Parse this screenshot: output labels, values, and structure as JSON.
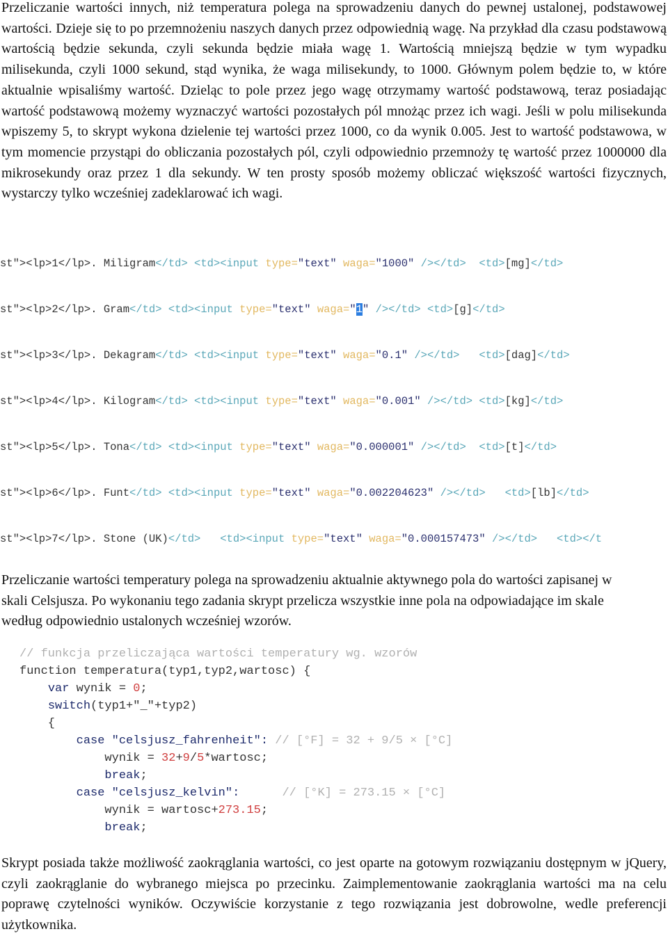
{
  "paragraphs": [
    "Przeliczanie wartości innych, niż temperatura polega na sprowadzeniu danych do pewnej ustalonej, podstawowej wartości. Dzieje się to po przemnożeniu naszych danych przez odpowiednią wagę. Na przykład dla czasu podstawową wartością będzie sekunda, czyli sekunda będzie miała wagę 1. Wartością mniejszą będzie w tym wypadku milisekunda, czyli 1000 sekund, stąd wynika, że waga milisekundy, to 1000. Głównym polem będzie to, w które aktualnie wpisaliśmy wartość. Dzieląc to pole przez jego wagę otrzymamy wartość podstawową, teraz posiadając wartość podstawową możemy wyznaczyć wartości pozostałych pól mnożąc przez ich wagi. Jeśli w polu milisekunda wpiszemy 5, to skrypt wykona dzielenie tej wartości przez 1000, co da wynik 0.005. Jest to wartość podstawowa, w tym momencie przystąpi do obliczania pozostałych pól, czyli odpowiednio przemnoży tę wartość przez 1000000 dla mikrosekundy oraz przez 1 dla sekundy. W ten prosty sposób możemy obliczać większość wartości fizycznych, wystarczy tylko wcześniej zadeklarować ich wagi.",
    "Przeliczanie wartości temperatury polega na sprowadzeniu aktualnie aktywnego pola do wartości zapisanej w skali Celsjusza. Po wykonaniu tego zadania skrypt przelicza wszystkie inne pola na odpowiadające im skale według odpowiednio ustalonych wcześniej wzorów.",
    "Skrypt posiada także możliwość zaokrąglania wartości, co jest oparte na gotowym rozwiązaniu dostępnym w jQuery, czyli zaokrąglanie do wybranego miejsca po przecinku. Zaimplementowanie zaokrąglania wartości ma na celu poprawę czytelności wyników. Oczywiście korzystanie z tego rozwiązania jest dobrowolne, wedle preferencji użytkownika."
  ],
  "html_code_lines": [
    [
      [
        "st\"><lp>1</lp>. Miligram",
        "p"
      ],
      [
        "</td> <td><input ",
        "t"
      ],
      [
        "type=",
        "a"
      ],
      [
        "\"text\" ",
        "s"
      ],
      [
        "waga=",
        "a"
      ],
      [
        "\"1000\" ",
        "s"
      ],
      [
        "/></td>  ",
        "t"
      ],
      [
        "<td>",
        "t"
      ],
      [
        "[mg]",
        "p"
      ],
      [
        "</td>",
        "t"
      ]
    ],
    [
      [
        "st\"><lp>2</lp>. Gram",
        "p"
      ],
      [
        "</td> <td><input ",
        "t"
      ],
      [
        "type=",
        "a"
      ],
      [
        "\"text\" ",
        "s"
      ],
      [
        "waga=",
        "a"
      ],
      [
        "\"",
        "s"
      ],
      [
        "1",
        "h"
      ],
      [
        "\" ",
        "s"
      ],
      [
        "/></td> ",
        "t"
      ],
      [
        "<td>",
        "t"
      ],
      [
        "[g]",
        "p"
      ],
      [
        "</td>",
        "t"
      ]
    ],
    [
      [
        "st\"><lp>3</lp>. Dekagram",
        "p"
      ],
      [
        "</td> <td><input ",
        "t"
      ],
      [
        "type=",
        "a"
      ],
      [
        "\"text\" ",
        "s"
      ],
      [
        "waga=",
        "a"
      ],
      [
        "\"0.1\" ",
        "s"
      ],
      [
        "/></td>   ",
        "t"
      ],
      [
        "<td>",
        "t"
      ],
      [
        "[dag]",
        "p"
      ],
      [
        "</td>",
        "t"
      ]
    ],
    [
      [
        "st\"><lp>4</lp>. Kilogram",
        "p"
      ],
      [
        "</td> <td><input ",
        "t"
      ],
      [
        "type=",
        "a"
      ],
      [
        "\"text\" ",
        "s"
      ],
      [
        "waga=",
        "a"
      ],
      [
        "\"0.001\" ",
        "s"
      ],
      [
        "/></td> ",
        "t"
      ],
      [
        "<td>",
        "t"
      ],
      [
        "[kg]",
        "p"
      ],
      [
        "</td>",
        "t"
      ]
    ],
    [
      [
        "st\"><lp>5</lp>. Tona",
        "p"
      ],
      [
        "</td> <td><input ",
        "t"
      ],
      [
        "type=",
        "a"
      ],
      [
        "\"text\" ",
        "s"
      ],
      [
        "waga=",
        "a"
      ],
      [
        "\"0.000001\" ",
        "s"
      ],
      [
        "/></td>  ",
        "t"
      ],
      [
        "<td>",
        "t"
      ],
      [
        "[t]",
        "p"
      ],
      [
        "</td>",
        "t"
      ]
    ],
    [
      [
        "st\"><lp>6</lp>. Funt",
        "p"
      ],
      [
        "</td> <td><input ",
        "t"
      ],
      [
        "type=",
        "a"
      ],
      [
        "\"text\" ",
        "s"
      ],
      [
        "waga=",
        "a"
      ],
      [
        "\"0.002204623\" ",
        "s"
      ],
      [
        "/></td>   ",
        "t"
      ],
      [
        "<td>",
        "t"
      ],
      [
        "[lb]",
        "p"
      ],
      [
        "</td>",
        "t"
      ]
    ],
    [
      [
        "st\"><lp>7</lp>. Stone (UK)",
        "p"
      ],
      [
        "</td>   <td><input ",
        "t"
      ],
      [
        "type=",
        "a"
      ],
      [
        "\"text\" ",
        "s"
      ],
      [
        "waga=",
        "a"
      ],
      [
        "\"0.000157473\" ",
        "s"
      ],
      [
        "/></td>   ",
        "t"
      ],
      [
        "<td></t",
        "t"
      ]
    ]
  ],
  "js_code_lines": [
    [
      [
        "// funkcja przeliczająca wartości temperatury wg. wzorów",
        "c"
      ]
    ],
    [
      [
        "function temperatura(typ1,typ2,wartosc) {",
        "p"
      ]
    ],
    [
      [
        "    ",
        "p"
      ],
      [
        "var",
        "k"
      ],
      [
        " wynik = ",
        "p"
      ],
      [
        "0",
        "n"
      ],
      [
        ";",
        "p"
      ]
    ],
    [
      [
        "    ",
        "p"
      ],
      [
        "switch",
        "k"
      ],
      [
        "(typ1+\"_\"+typ2)",
        "p"
      ]
    ],
    [
      [
        "    {",
        "p"
      ]
    ],
    [
      [
        "        ",
        "p"
      ],
      [
        "case",
        "k"
      ],
      [
        " \"celsjusz_fahrenheit\": ",
        "k"
      ],
      [
        "// [°F] = 32 + 9/5 × [°C]",
        "c"
      ]
    ],
    [
      [
        "            wynik = ",
        "p"
      ],
      [
        "32",
        "n"
      ],
      [
        "+",
        "p"
      ],
      [
        "9",
        "n"
      ],
      [
        "/",
        "p"
      ],
      [
        "5",
        "n"
      ],
      [
        "*wartosc;",
        "p"
      ]
    ],
    [
      [
        "            ",
        "p"
      ],
      [
        "break",
        "k"
      ],
      [
        ";",
        "p"
      ]
    ],
    [
      [
        "        ",
        "p"
      ],
      [
        "case",
        "k"
      ],
      [
        " \"celsjusz_kelvin\":      ",
        "k"
      ],
      [
        "// [°K] = 273.15 × [°C]",
        "c"
      ]
    ],
    [
      [
        "            wynik = wartosc+",
        "p"
      ],
      [
        "273.15",
        "n"
      ],
      [
        ";",
        "p"
      ]
    ],
    [
      [
        "            ",
        "p"
      ],
      [
        "break",
        "k"
      ],
      [
        ";",
        "p"
      ]
    ]
  ]
}
